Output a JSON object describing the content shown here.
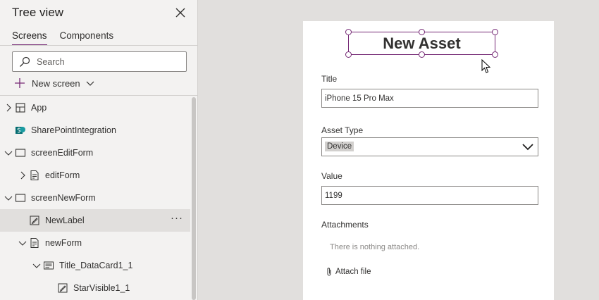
{
  "panel": {
    "title": "Tree view",
    "tabs": [
      {
        "label": "Screens",
        "active": true
      },
      {
        "label": "Components",
        "active": false
      }
    ],
    "search_placeholder": "Search",
    "new_screen_label": "New screen"
  },
  "tree": [
    {
      "label": "App",
      "icon": "app-icon",
      "expander": "collapsed",
      "depth": 0
    },
    {
      "label": "SharePointIntegration",
      "icon": "sharepoint-icon",
      "expander": "none",
      "depth": 0
    },
    {
      "label": "screenEditForm",
      "icon": "screen-icon",
      "expander": "expanded",
      "depth": 0
    },
    {
      "label": "editForm",
      "icon": "form-icon",
      "expander": "collapsed",
      "depth": 1
    },
    {
      "label": "screenNewForm",
      "icon": "screen-icon",
      "expander": "expanded",
      "depth": 0
    },
    {
      "label": "NewLabel",
      "icon": "label-icon",
      "expander": "none",
      "depth": 1,
      "selected": true,
      "more": "···"
    },
    {
      "label": "newForm",
      "icon": "form-icon",
      "expander": "expanded",
      "depth": 1
    },
    {
      "label": "Title_DataCard1_1",
      "icon": "datacard-icon",
      "expander": "expanded",
      "depth": 2
    },
    {
      "label": "StarVisible1_1",
      "icon": "label-icon",
      "expander": "none",
      "depth": 3
    }
  ],
  "canvas": {
    "heading": "New Asset",
    "fields": {
      "title_label": "Title",
      "title_value": "iPhone 15 Pro Max",
      "asset_type_label": "Asset Type",
      "asset_type_value": "Device",
      "value_label": "Value",
      "value_value": "1199",
      "attachments_label": "Attachments",
      "attachments_empty": "There is nothing attached.",
      "attach_file_label": "Attach file"
    }
  },
  "colors": {
    "accent": "#742774",
    "panel_bg": "#f3f2f1",
    "canvas_bg": "#e1dfdd",
    "selected_bg": "#e1dfdd"
  }
}
